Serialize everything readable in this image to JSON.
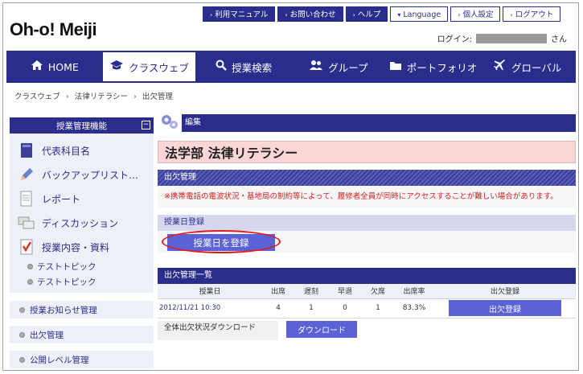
{
  "header": {
    "logo": "Oh-o! Meiji",
    "util_links": [
      {
        "label": "利用マニュアル",
        "arrow": "›"
      },
      {
        "label": "お問い合わせ",
        "arrow": "›"
      },
      {
        "label": "ヘルプ",
        "arrow": "›"
      },
      {
        "label": "Language",
        "arrow": "▾"
      },
      {
        "label": "個人設定",
        "arrow": "›"
      },
      {
        "label": "ログアウト",
        "arrow": "›"
      }
    ],
    "login_label": "ログイン:",
    "login_suffix": "さん"
  },
  "nav": [
    {
      "label": "HOME",
      "icon": "home-icon"
    },
    {
      "label": "クラスウェブ",
      "icon": "mortarboard-icon"
    },
    {
      "label": "授業検索",
      "icon": "search-icon"
    },
    {
      "label": "グループ",
      "icon": "people-icon"
    },
    {
      "label": "ポートフォリオ",
      "icon": "folder-icon"
    },
    {
      "label": "グローバル",
      "icon": "plane-icon"
    }
  ],
  "breadcrumb": [
    "クラスウェブ",
    "法律リテラシー",
    "出欠管理"
  ],
  "breadcrumb_sep": "›",
  "sidebar": {
    "title": "授業管理機能",
    "toggle": "−",
    "items": [
      {
        "label": "代表科目名",
        "icon": "book-icon"
      },
      {
        "label": "バックアップリスト…",
        "icon": "pencil-icon"
      },
      {
        "label": "レポート",
        "icon": "document-icon"
      },
      {
        "label": "ディスカッション",
        "icon": "discussion-icon"
      },
      {
        "label": "授業内容・資料",
        "icon": "notebook-icon"
      }
    ],
    "subitems": [
      "テストトピック",
      "テストトピック"
    ],
    "links": [
      "授業お知らせ管理",
      "出欠管理",
      "公開レベル管理"
    ]
  },
  "main": {
    "edit_label": "編集",
    "course_title": "法学部 法律リテラシー",
    "attendance_header": "出欠管理",
    "warning": "※携帯電話の電波状況・基地局の制約等によって、履修者全員が同時にアクセスすることが難しい場合があります。",
    "register_header": "授業日登録",
    "register_button": "授業日を登録",
    "list_header": "出欠管理一覧",
    "columns": [
      "授業日",
      "出席",
      "遅刻",
      "早退",
      "欠席",
      "出席率",
      "出欠登録"
    ],
    "rows": [
      {
        "date": "2012/11/21 10:30",
        "present": "4",
        "late": "1",
        "early": "0",
        "absent": "1",
        "rate": "83.3%",
        "action": "出欠登録"
      }
    ],
    "download_label": "全体出欠状況ダウンロード",
    "download_button": "ダウンロード"
  },
  "colors": {
    "brand": "#2a2d8c",
    "button": "#5a62d6",
    "warning": "#d21f1f",
    "title_bg": "#fbd6d6",
    "highlight_ring": "#e01b1b"
  }
}
